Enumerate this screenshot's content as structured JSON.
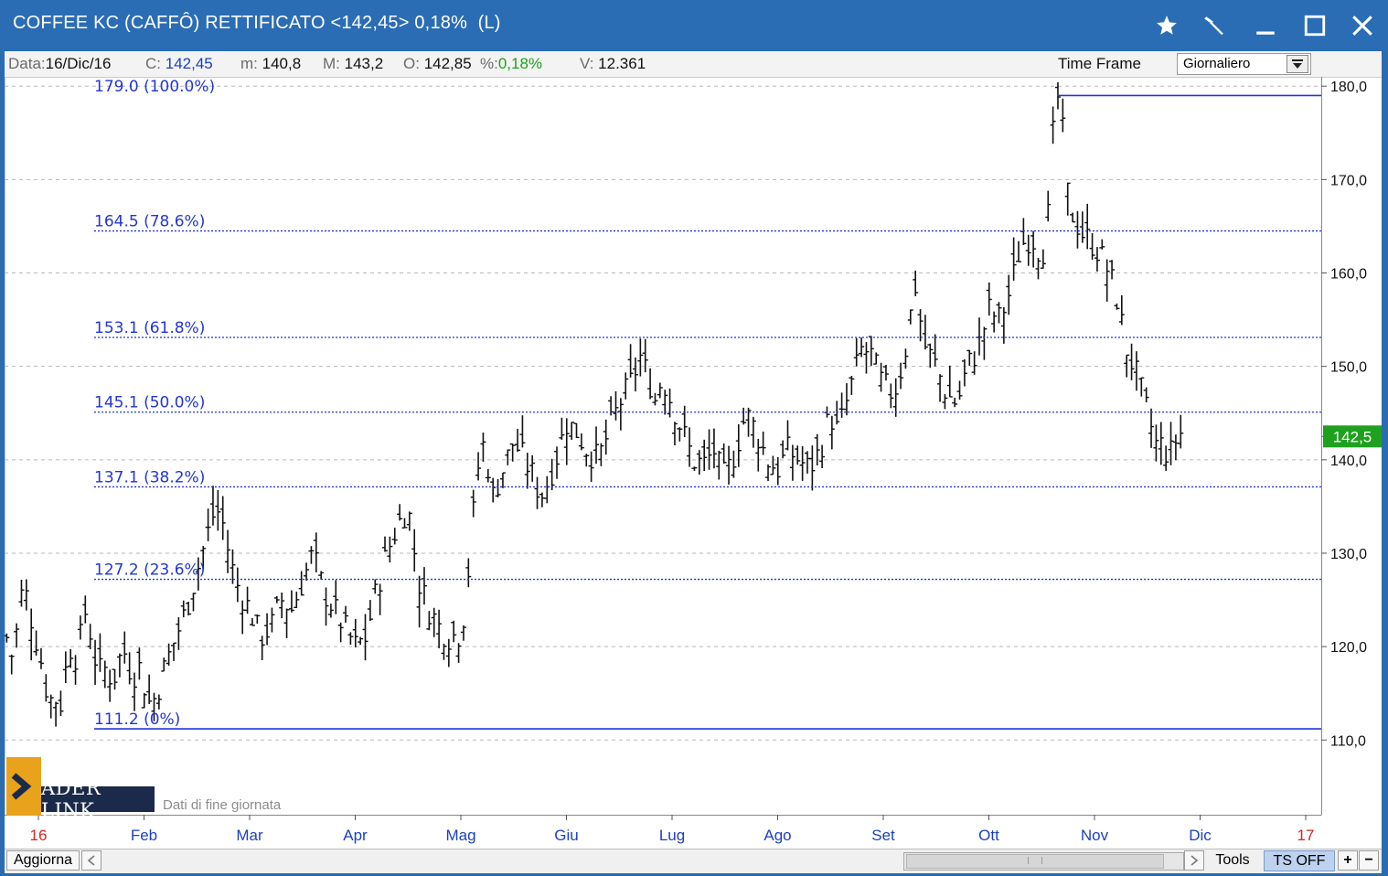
{
  "window": {
    "title": "COFFEE KC (CAFFÔ) RETTIFICATO <142,45> 0,18%  (L)",
    "icons": [
      "star-icon",
      "hammer-icon",
      "minimize-icon",
      "maximize-icon",
      "close-icon"
    ]
  },
  "info": {
    "data_label": "Data:",
    "data_value": "16/Dic/16",
    "c_label": "C:",
    "c_value": "142,45",
    "m_label": "m:",
    "m_value": "140,8",
    "M_label": "M:",
    "M_value": "143,2",
    "o_label": "O:",
    "o_value": "142,85",
    "pct_label": "%:",
    "pct_value": "0,18%",
    "v_label": "V:",
    "v_value": "12.361",
    "timeframe_label": "Time Frame",
    "timeframe_value": "Giornaliero"
  },
  "logo": {
    "text": "ADER LINK",
    "caption": "Dati di fine giornata"
  },
  "status": {
    "aggiorna": "Aggiorna",
    "tools": "Tools",
    "ts": "TS OFF",
    "plus": "+",
    "minus": "−"
  },
  "colors": {
    "accent": "#2a6db5",
    "fib": "#2236d6",
    "price_tag": "#1ea11e",
    "price_bars": "#111111"
  },
  "chart_data": {
    "type": "bar",
    "ylim": [
      102,
      181
    ],
    "y_ticks": [
      "180,0",
      "170,0",
      "160,0",
      "150,0",
      "140,0",
      "130,0",
      "120,0",
      "110,0"
    ],
    "y_tick_values": [
      180,
      170,
      160,
      150,
      140,
      130,
      120,
      110
    ],
    "x_tick_labels": [
      {
        "label": "16",
        "m": 0,
        "red": true
      },
      {
        "label": "Feb",
        "m": 1
      },
      {
        "label": "Mar",
        "m": 2
      },
      {
        "label": "Apr",
        "m": 3
      },
      {
        "label": "Mag",
        "m": 4
      },
      {
        "label": "Giu",
        "m": 5
      },
      {
        "label": "Lug",
        "m": 6
      },
      {
        "label": "Ago",
        "m": 7
      },
      {
        "label": "Set",
        "m": 8
      },
      {
        "label": "Ott",
        "m": 9
      },
      {
        "label": "Nov",
        "m": 10
      },
      {
        "label": "Dic",
        "m": 11
      },
      {
        "label": "17",
        "m": 12,
        "red": true
      }
    ],
    "current_price_label": "142,5",
    "current_price": 142.5,
    "fib_levels": [
      {
        "label": "179.0 (100.0%)",
        "value": 179.0
      },
      {
        "label": "164.5 (78.6%)",
        "value": 164.5
      },
      {
        "label": "153.1 (61.8%)",
        "value": 153.1
      },
      {
        "label": "145.1 (50.0%)",
        "value": 145.1
      },
      {
        "label": "137.1 (38.2%)",
        "value": 137.1
      },
      {
        "label": "127.2 (23.6%)",
        "value": 127.2
      },
      {
        "label": "111.2 (0%)",
        "value": 111.2
      }
    ],
    "price_path": [
      [
        -0.3,
        121
      ],
      [
        -0.25,
        119
      ],
      [
        -0.2,
        122
      ],
      [
        -0.15,
        126.5
      ],
      [
        -0.1,
        125
      ],
      [
        -0.05,
        122
      ],
      [
        0.0,
        120
      ],
      [
        0.05,
        117
      ],
      [
        0.1,
        114
      ],
      [
        0.15,
        115
      ],
      [
        0.2,
        113
      ],
      [
        0.25,
        117
      ],
      [
        0.3,
        120
      ],
      [
        0.35,
        119
      ],
      [
        0.4,
        121
      ],
      [
        0.45,
        124
      ],
      [
        0.5,
        121
      ],
      [
        0.55,
        118
      ],
      [
        0.6,
        117
      ],
      [
        0.65,
        118
      ],
      [
        0.7,
        116
      ],
      [
        0.75,
        118
      ],
      [
        0.8,
        120
      ],
      [
        0.85,
        118
      ],
      [
        0.9,
        117
      ],
      [
        0.95,
        118
      ],
      [
        1.0,
        116
      ],
      [
        1.05,
        114
      ],
      [
        1.1,
        114.5
      ],
      [
        1.15,
        116
      ],
      [
        1.2,
        118
      ],
      [
        1.3,
        121
      ],
      [
        1.4,
        124
      ],
      [
        1.5,
        128
      ],
      [
        1.6,
        132
      ],
      [
        1.68,
        135
      ],
      [
        1.75,
        133
      ],
      [
        1.82,
        129
      ],
      [
        1.9,
        126
      ],
      [
        2.0,
        124
      ],
      [
        2.1,
        121
      ],
      [
        2.2,
        122
      ],
      [
        2.3,
        125
      ],
      [
        2.4,
        124
      ],
      [
        2.5,
        127
      ],
      [
        2.6,
        130
      ],
      [
        2.7,
        126
      ],
      [
        2.8,
        124
      ],
      [
        2.9,
        122
      ],
      [
        3.0,
        120
      ],
      [
        3.1,
        121
      ],
      [
        3.2,
        126
      ],
      [
        3.3,
        130
      ],
      [
        3.4,
        133
      ],
      [
        3.5,
        135
      ],
      [
        3.55,
        131
      ],
      [
        3.6,
        127
      ],
      [
        3.7,
        124
      ],
      [
        3.8,
        122
      ],
      [
        3.9,
        121
      ],
      [
        4.0,
        121.5
      ],
      [
        4.05,
        125
      ],
      [
        4.1,
        132
      ],
      [
        4.15,
        138
      ],
      [
        4.2,
        142
      ],
      [
        4.25,
        140
      ],
      [
        4.3,
        136
      ],
      [
        4.4,
        139
      ],
      [
        4.5,
        142
      ],
      [
        4.6,
        140
      ],
      [
        4.7,
        138
      ],
      [
        4.75,
        136
      ],
      [
        4.8,
        137
      ],
      [
        4.9,
        140
      ],
      [
        5.0,
        144
      ],
      [
        5.1,
        143
      ],
      [
        5.2,
        141
      ],
      [
        5.3,
        140
      ],
      [
        5.4,
        143
      ],
      [
        5.5,
        146
      ],
      [
        5.6,
        148
      ],
      [
        5.7,
        151
      ],
      [
        5.8,
        148
      ],
      [
        5.85,
        146
      ],
      [
        5.9,
        149
      ],
      [
        6.0,
        146
      ],
      [
        6.1,
        143
      ],
      [
        6.2,
        140
      ],
      [
        6.3,
        139.5
      ],
      [
        6.4,
        141
      ],
      [
        6.45,
        139
      ],
      [
        6.5,
        138
      ],
      [
        6.6,
        141
      ],
      [
        6.7,
        145
      ],
      [
        6.8,
        143
      ],
      [
        6.9,
        140
      ],
      [
        7.0,
        139
      ],
      [
        7.1,
        141
      ],
      [
        7.2,
        140
      ],
      [
        7.3,
        139
      ],
      [
        7.4,
        141
      ],
      [
        7.5,
        145
      ],
      [
        7.55,
        143
      ],
      [
        7.6,
        144
      ],
      [
        7.7,
        148
      ],
      [
        7.8,
        152
      ],
      [
        7.9,
        151
      ],
      [
        7.95,
        149
      ],
      [
        8.0,
        148
      ],
      [
        8.1,
        147
      ],
      [
        8.2,
        151
      ],
      [
        8.3,
        159
      ],
      [
        8.35,
        155
      ],
      [
        8.4,
        152
      ],
      [
        8.5,
        150
      ],
      [
        8.6,
        147
      ],
      [
        8.7,
        146
      ],
      [
        8.8,
        150
      ],
      [
        8.9,
        152
      ],
      [
        9.0,
        156
      ],
      [
        9.1,
        155
      ],
      [
        9.2,
        158
      ],
      [
        9.3,
        163
      ],
      [
        9.4,
        164
      ],
      [
        9.5,
        162
      ],
      [
        9.55,
        164
      ],
      [
        9.6,
        174
      ],
      [
        9.65,
        179
      ],
      [
        9.7,
        175
      ],
      [
        9.75,
        168
      ],
      [
        9.8,
        166
      ],
      [
        9.9,
        164
      ],
      [
        10.0,
        163
      ],
      [
        10.1,
        161
      ],
      [
        10.2,
        158
      ],
      [
        10.3,
        152
      ],
      [
        10.4,
        149
      ],
      [
        10.5,
        145
      ],
      [
        10.55,
        143
      ],
      [
        10.6,
        141
      ],
      [
        10.65,
        142
      ],
      [
        10.7,
        140
      ],
      [
        10.75,
        141.5
      ],
      [
        10.8,
        143
      ],
      [
        10.85,
        142.5
      ]
    ]
  }
}
